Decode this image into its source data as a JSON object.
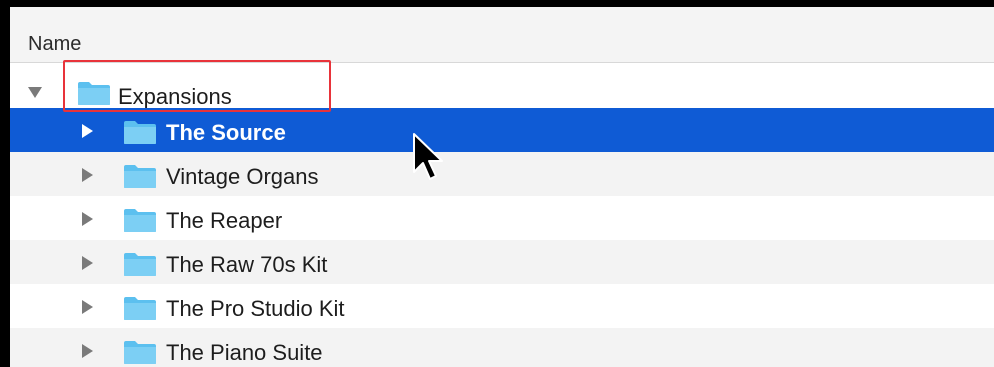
{
  "column_header": {
    "label": "Name"
  },
  "tree": {
    "parent": {
      "label": "Expansions",
      "expanded": true,
      "icon": "folder-icon"
    },
    "children": [
      {
        "label": "The Source",
        "selected": true,
        "icon": "folder-icon"
      },
      {
        "label": "Vintage Organs",
        "selected": false,
        "icon": "folder-icon"
      },
      {
        "label": "The Reaper",
        "selected": false,
        "icon": "folder-icon"
      },
      {
        "label": "The Raw 70s Kit",
        "selected": false,
        "icon": "folder-icon"
      },
      {
        "label": "The Pro Studio Kit",
        "selected": false,
        "icon": "folder-icon"
      },
      {
        "label": "The Piano Suite",
        "selected": false,
        "icon": "folder-icon"
      }
    ]
  },
  "colors": {
    "selection": "#0f5bd5",
    "folder": "#5cc0ef",
    "highlight_box": "#e8333a",
    "alt_row": "#f3f3f3"
  },
  "annotation": {
    "type": "highlight-box",
    "target": "Expansions"
  },
  "pointer": {
    "icon": "mouse-pointer-icon"
  }
}
